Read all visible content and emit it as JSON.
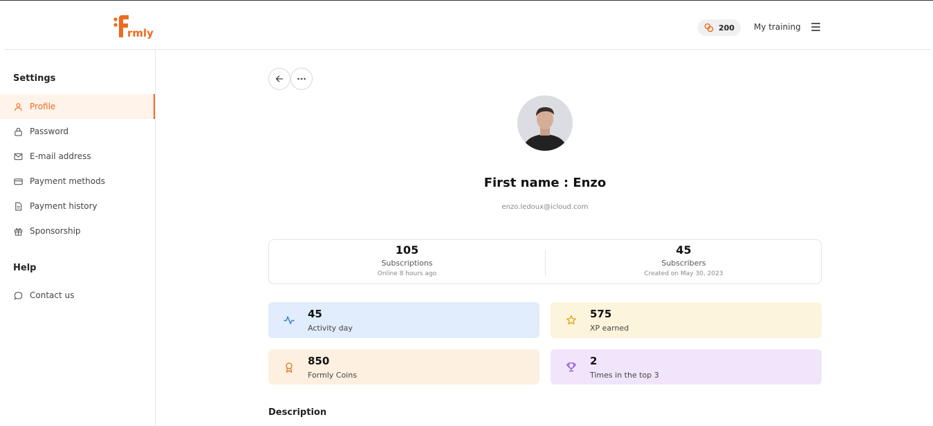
{
  "header": {
    "logo_text": "Formly",
    "coins": "200",
    "my_training": "My training"
  },
  "sidebar": {
    "settings_heading": "Settings",
    "settings_items": [
      {
        "label": "Profile",
        "icon": "user-icon"
      },
      {
        "label": "Password",
        "icon": "lock-icon"
      },
      {
        "label": "E-mail address",
        "icon": "mail-icon"
      },
      {
        "label": "Payment methods",
        "icon": "credit-card-icon"
      },
      {
        "label": "Payment history",
        "icon": "document-icon"
      },
      {
        "label": "Sponsorship",
        "icon": "gift-icon"
      }
    ],
    "help_heading": "Help",
    "help_items": [
      {
        "label": "Contact us",
        "icon": "chat-bubble-icon"
      }
    ]
  },
  "profile": {
    "name": "First name : Enzo",
    "email": "enzo.ledoux@icloud.com",
    "stats": [
      {
        "value": "105",
        "label": "Subscriptions",
        "sub": "Online 8 hours ago"
      },
      {
        "value": "45",
        "label": "Subscribers",
        "sub": "Created on May 30, 2023"
      }
    ],
    "cards": [
      {
        "value": "45",
        "label": "Activity day",
        "icon": "activity-icon"
      },
      {
        "value": "575",
        "label": "XP earned",
        "icon": "star-icon"
      },
      {
        "value": "850",
        "label": "Formly Coins",
        "icon": "award-icon"
      },
      {
        "value": "2",
        "label": "Times in the top 3",
        "icon": "trophy-icon"
      }
    ],
    "description_heading": "Description"
  },
  "colors": {
    "accent": "#ef6a1f",
    "card_blue": "#e1ecfc",
    "card_yellow": "#fdf4dc",
    "card_orange": "#fdf0e0",
    "card_purple": "#f1e5fc"
  }
}
